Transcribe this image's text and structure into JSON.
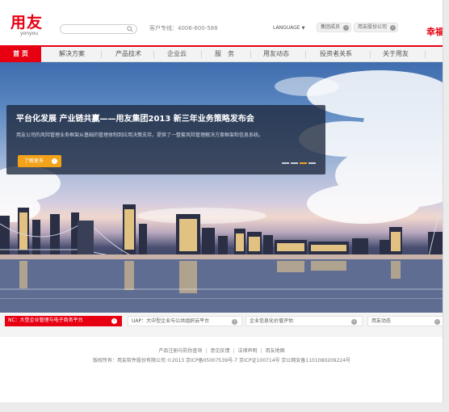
{
  "header": {
    "logo": {
      "cn": "用友",
      "en": "yonyou"
    },
    "hotline": "客户专线：4006-600-588",
    "language_label": "LANGUAGE",
    "links": [
      {
        "label": "集团成员"
      },
      {
        "label": "用友股份公司"
      }
    ],
    "slogan": "幸福"
  },
  "nav": {
    "items": [
      {
        "label": "首 页"
      },
      {
        "label": "解决方案"
      },
      {
        "label": "产品技术"
      },
      {
        "label": "企业云"
      },
      {
        "label": "服　务"
      },
      {
        "label": "用友动态"
      },
      {
        "label": "投资者关系"
      },
      {
        "label": "关于用友"
      }
    ]
  },
  "banner": {
    "title": "平台化发展 产业链共赢——用友集团2013 新三年业务策略发布会",
    "description": "用友公司的风险管理业务框架从基础的管理体制到应用决策支持，提供了一整套风险管理解决方案框架和信息系统。",
    "more_label": "了解更多",
    "slides_total": 4,
    "active_slide": 3
  },
  "tabs": [
    {
      "label": "NC：大型企业管理与电子商务平台"
    },
    {
      "label": "UAP：大中型企业与公共组织云平台"
    },
    {
      "label": "企业信息化价值评估"
    },
    {
      "label": "用友动态"
    }
  ],
  "footer": {
    "links": [
      "产品注册与防伪查询",
      "意见反馈",
      "法律声明",
      "用友地图"
    ],
    "copyright": "版权所有：用友软件股份有限公司 ©2013 京ICP备05007539号-7 京ICP证100714号 京公网安备1101080209224号"
  },
  "colors": {
    "brand": "#e60012",
    "accent": "#f3a21a",
    "nav_bg": "#f3f3f3"
  }
}
